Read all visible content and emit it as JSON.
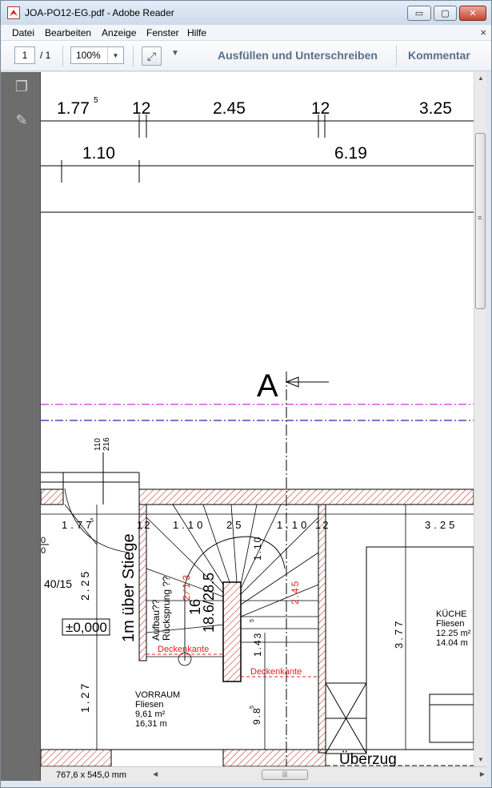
{
  "window": {
    "title": "JOA-PO12-EG.pdf - Adobe Reader",
    "min_label": "▭",
    "max_label": "▢",
    "close_label": "✕"
  },
  "menu": {
    "items": [
      "Datei",
      "Bearbeiten",
      "Anzeige",
      "Fenster",
      "Hilfe"
    ],
    "close_label": "×"
  },
  "toolbar": {
    "page_value": "1",
    "page_total": "/ 1",
    "zoom_value": "100%",
    "fill_sign_label": "Ausfüllen und Unterschreiben",
    "comment_label": "Kommentar"
  },
  "status": {
    "page_size": "767,6 x 545,0 mm"
  },
  "drawing": {
    "dim_top": [
      "1.77",
      "5",
      "12",
      "2.45",
      "12",
      "3.25"
    ],
    "dim_second": [
      "1.10",
      "6.19"
    ],
    "section_marker": "A",
    "vertical_dims_small": [
      "110",
      "216"
    ],
    "room_dims_row": [
      "1.77",
      "5",
      "12",
      "1.10",
      "25",
      "1.10",
      "12",
      "3.25"
    ],
    "left_fragment_1": "0",
    "left_fragment_2": "0",
    "label_40_15": "40/15",
    "label_225": "2.25",
    "level_label": "±0,000",
    "label_127": "1.27",
    "label_1m": "1m über Stiege",
    "label_aufbau": "Aufbau??",
    "label_ruecksprung": "Rücksprung ??",
    "label_red_213": "2 ⁄ 1 3",
    "label_16": "16",
    "label_stair": "18.6/28.5",
    "label_110_v": "1.10",
    "label_red_245": "2.45",
    "label_143": "1.43",
    "label_143_sup": "5",
    "label_deckenkante_1": "Deckenkante",
    "label_deckenkante_2": "Deckenkante",
    "label_377": "3.77",
    "label_98": "9.8",
    "label_98_sup": "5",
    "room_vorraum": "VORRAUM",
    "vorraum_floor": "Fliesen",
    "vorraum_area": "9,61 m²",
    "vorraum_perim": "16,31 m",
    "room_kueche": "KÜCHE",
    "kueche_floor": "Fliesen",
    "kueche_area": "12.25 m²",
    "kueche_perim": "14.04 m",
    "label_ueberzug": "Überzug"
  },
  "colors": {
    "hatch": "#c0392b",
    "magenta_line": "#c23bd4",
    "blue_line": "#1c2fa0",
    "red_text": "#e02020",
    "title_link": "#5a6f89"
  }
}
